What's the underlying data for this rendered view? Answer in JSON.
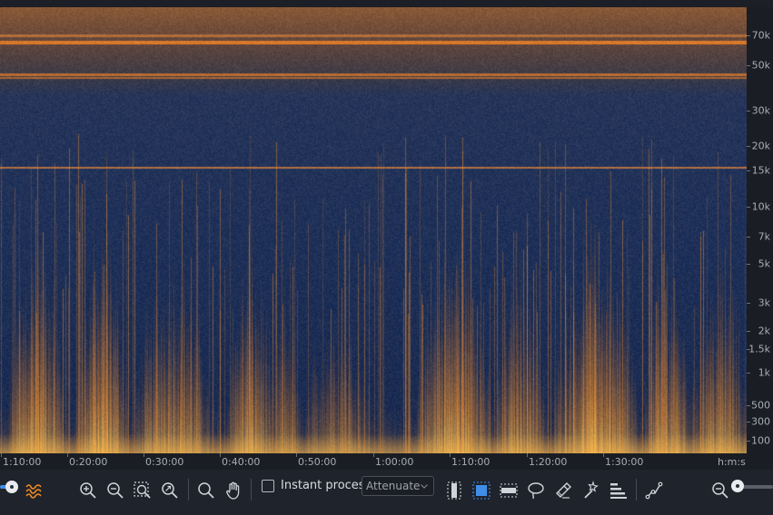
{
  "spectrogram": {
    "freq_ticks": [
      "70k",
      "50k",
      "30k",
      "20k",
      "15k",
      "10k",
      "7k",
      "5k",
      "3k",
      "2k",
      "1.5k",
      "1k",
      "500",
      "300",
      "100"
    ],
    "time_ticks": [
      "1:10:00",
      "0:20:00",
      "0:30:00",
      "0:40:00",
      "0:50:00",
      "1:00:00",
      "1:10:00",
      "1:20:00",
      "1:30:00"
    ],
    "time_unit": "h:m:s"
  },
  "toolbar": {
    "instant_process_label": "Instant process",
    "mode_value": "Attenuate"
  },
  "colors": {
    "accent": "#3e8ee8",
    "spectrum_orange": "#f08a20",
    "background_blue": "#1d2f55"
  }
}
